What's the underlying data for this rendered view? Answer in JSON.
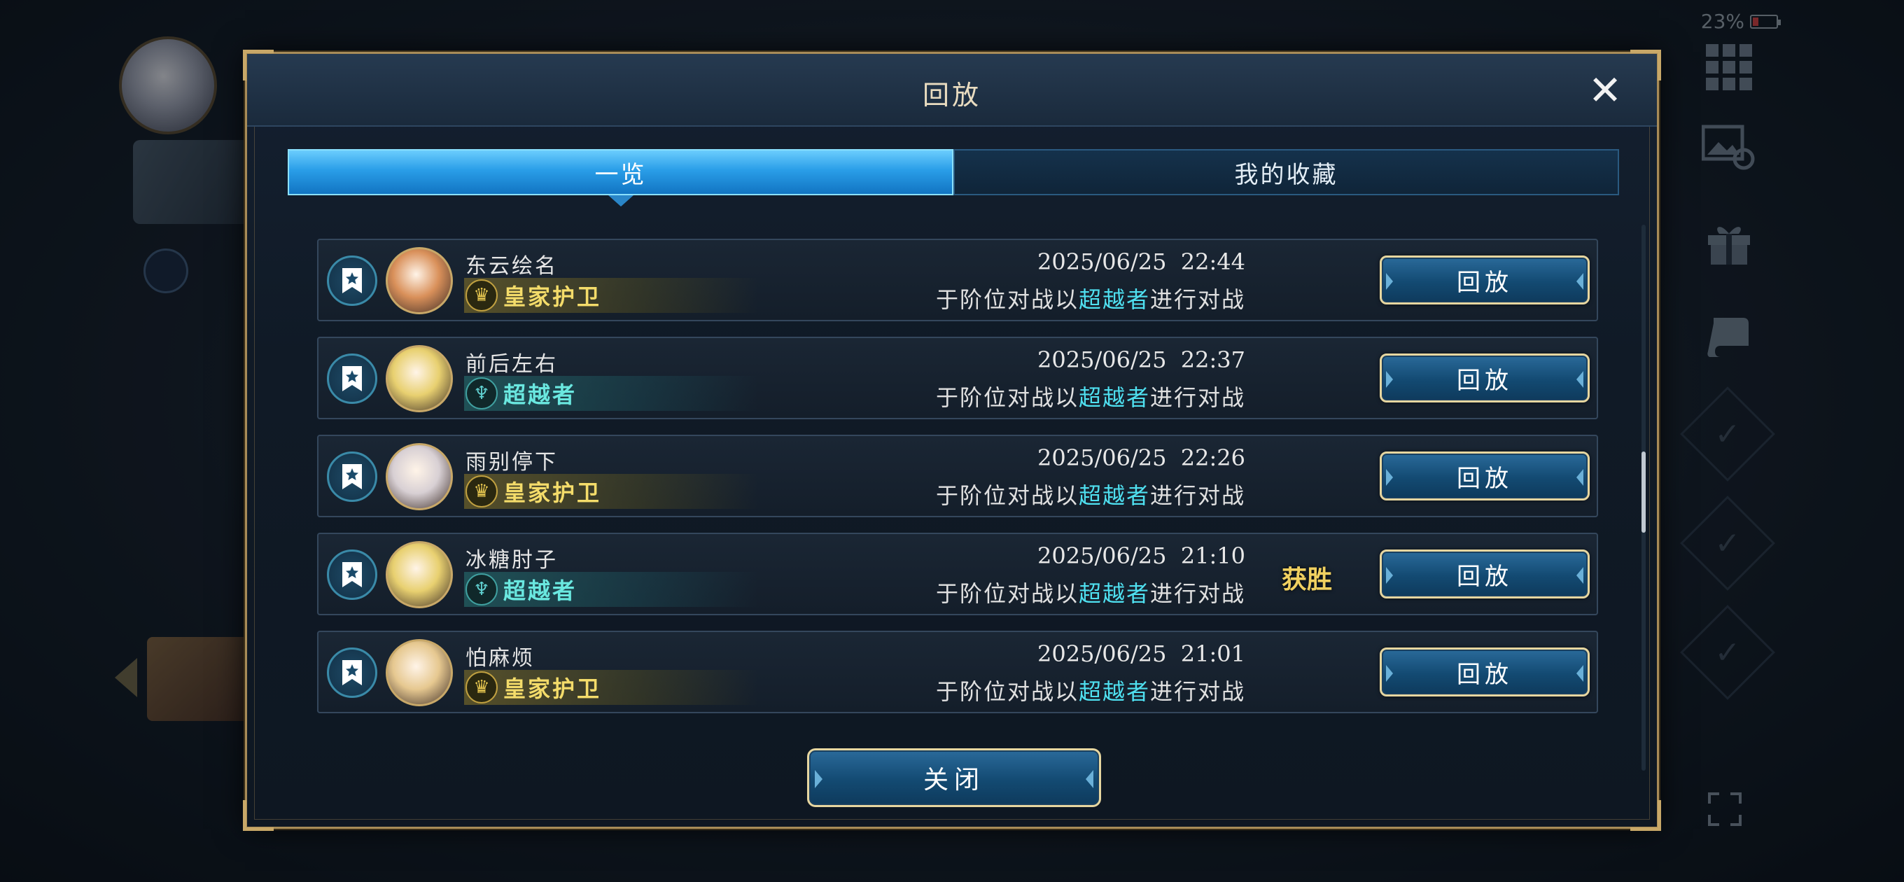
{
  "status_bar": {
    "battery": "23%"
  },
  "modal": {
    "title": "回放",
    "close_icon": "close-icon",
    "tabs": [
      {
        "label": "一览",
        "active": true
      },
      {
        "label": "我的收藏",
        "active": false
      }
    ],
    "rows": [
      {
        "name": "东云绘名",
        "rank": "皇家护卫",
        "rank_style": "gold",
        "date": "2025/06/25  22:44",
        "desc_prefix": "于阶位对战以",
        "desc_class": "超越者",
        "desc_suffix": "进行对战",
        "result": "",
        "replay_label": "回放",
        "avatar_color": "#d9905a"
      },
      {
        "name": "前后左右",
        "rank": "超越者",
        "rank_style": "teal",
        "date": "2025/06/25  22:37",
        "desc_prefix": "于阶位对战以",
        "desc_class": "超越者",
        "desc_suffix": "进行对战",
        "result": "",
        "replay_label": "回放",
        "avatar_color": "#e8d070"
      },
      {
        "name": "雨别停下",
        "rank": "皇家护卫",
        "rank_style": "gold",
        "date": "2025/06/25  22:26",
        "desc_prefix": "于阶位对战以",
        "desc_class": "超越者",
        "desc_suffix": "进行对战",
        "result": "",
        "replay_label": "回放",
        "avatar_color": "#d8d0d4"
      },
      {
        "name": "冰糖肘子",
        "rank": "超越者",
        "rank_style": "teal",
        "date": "2025/06/25  21:10",
        "desc_prefix": "于阶位对战以",
        "desc_class": "超越者",
        "desc_suffix": "进行对战",
        "result": "获胜",
        "replay_label": "回放",
        "avatar_color": "#e8d070"
      },
      {
        "name": "怕麻烦",
        "rank": "皇家护卫",
        "rank_style": "gold",
        "date": "2025/06/25  21:01",
        "desc_prefix": "于阶位对战以",
        "desc_class": "超越者",
        "desc_suffix": "进行对战",
        "result": "",
        "replay_label": "回放",
        "avatar_color": "#e6c890"
      }
    ],
    "close_button_label": "关闭"
  },
  "colors": {
    "accent_teal": "#4fe0f0",
    "gold_text": "#f4dc6a",
    "win_text": "#f0d060",
    "tab_active": "#2a9ee8"
  }
}
